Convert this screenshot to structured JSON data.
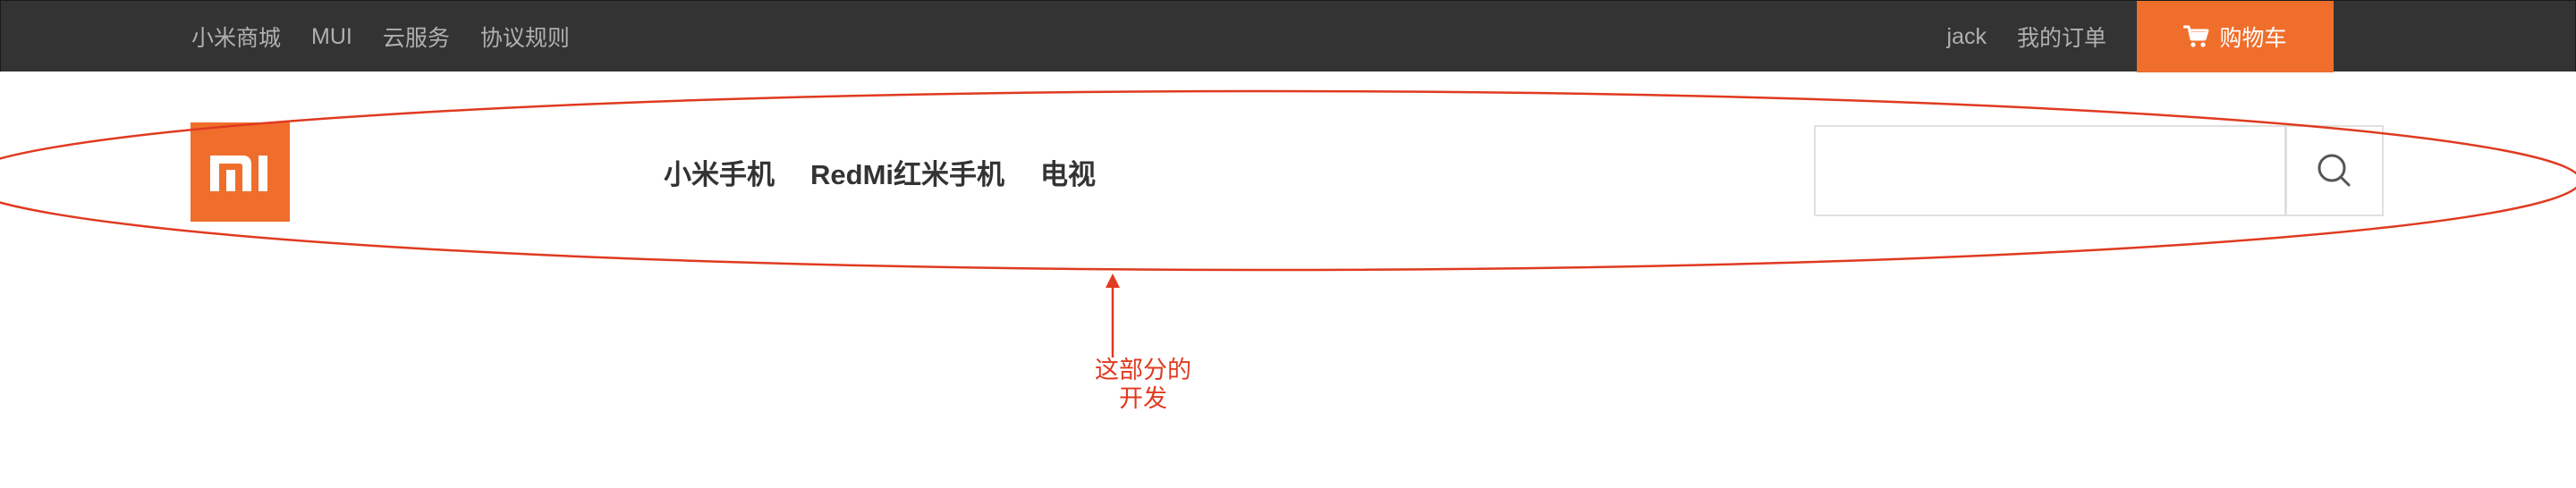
{
  "topbar": {
    "links": [
      "小米商城",
      "MUI",
      "云服务",
      "协议规则"
    ],
    "user": "jack",
    "orders": "我的订单",
    "cart_label": "购物车",
    "background": "#333333",
    "link_color": "#b0b0b0"
  },
  "header": {
    "logo_text": "mi",
    "nav": [
      "小米手机",
      "RedMi红米手机",
      "电视"
    ],
    "search_placeholder": "",
    "search_icon": "search-icon"
  },
  "annotation": {
    "line1": "这部分的",
    "line2": "开发",
    "color": "#e03a20"
  },
  "colors": {
    "brand": "#f06e2b",
    "nav_text": "#333333"
  }
}
